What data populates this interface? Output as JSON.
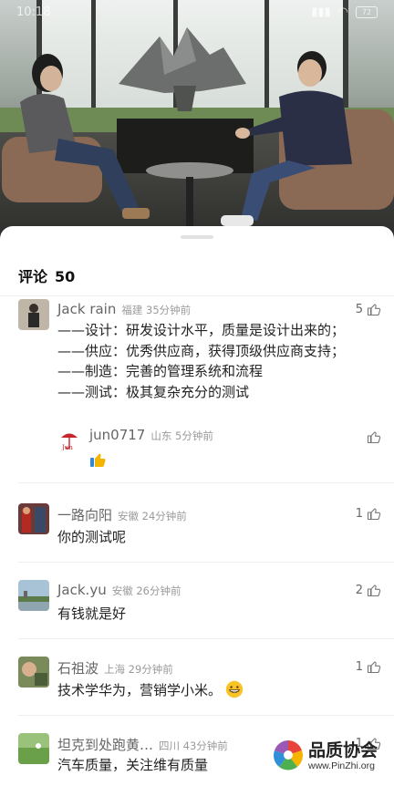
{
  "status_bar": {
    "time": "10:18",
    "battery": "72"
  },
  "comments_panel": {
    "title": "评论",
    "count": "50"
  },
  "comments": [
    {
      "user": "Jack rain",
      "location": "福建",
      "time": "35分钟前",
      "likes": "5",
      "lines": [
        "——设计：研发设计水平，质量是设计出来的；",
        "——供应：优秀供应商，获得顶级供应商支持；",
        "——制造：完善的管理系统和流程",
        "——测试：极其复杂充分的测试"
      ],
      "reply": {
        "user": "jun0717",
        "location": "山东",
        "time": "5分钟前",
        "emoji": "thumbs-up-emoji"
      }
    },
    {
      "user": "一路向阳",
      "location": "安徽",
      "time": "24分钟前",
      "likes": "1",
      "text": "你的测试呢"
    },
    {
      "user": "Jack.yu",
      "location": "安徽",
      "time": "26分钟前",
      "likes": "2",
      "text": "有钱就是好"
    },
    {
      "user": "石祖波",
      "location": "上海",
      "time": "29分钟前",
      "likes": "1",
      "text": "技术学华为，营销学小米。",
      "emoji": "grinning-face-emoji"
    },
    {
      "user": "坦克到处跑黄…",
      "location": "四川",
      "time": "43分钟前",
      "likes": "1",
      "text": "汽车质量，关注维有质量"
    }
  ],
  "watermark": {
    "title": "品质协会",
    "url": "www.PinZhi.org"
  },
  "colors": {
    "accent": "#f5b400",
    "meta": "#9a9a9a",
    "divider": "#efefef"
  }
}
